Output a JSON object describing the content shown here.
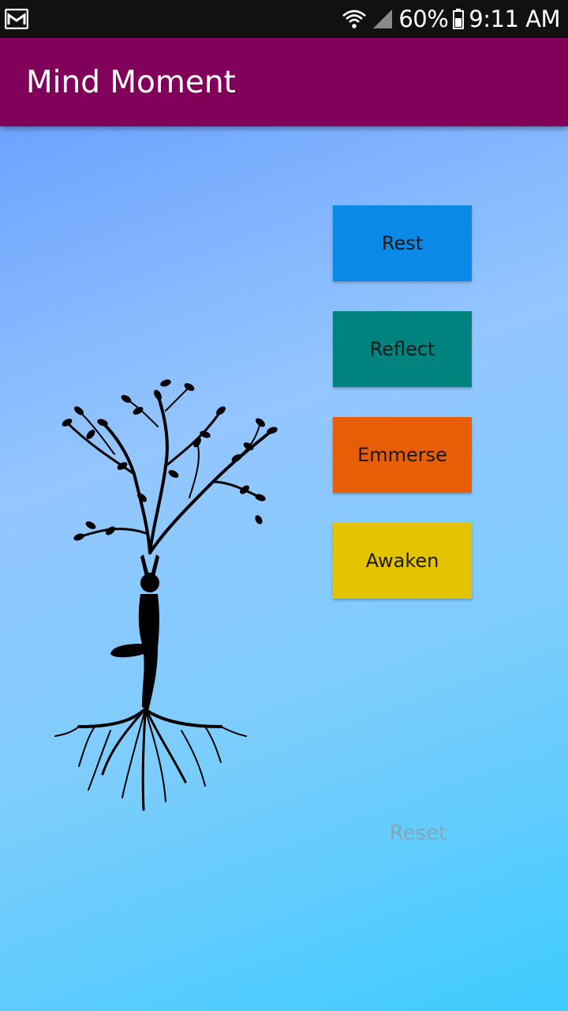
{
  "status_bar": {
    "battery": "60%",
    "time": "9:11 AM",
    "icons": [
      "gmail-icon",
      "wifi-icon",
      "signal-icon",
      "battery-icon"
    ]
  },
  "app_bar": {
    "title": "Mind Moment",
    "color": "#80005a"
  },
  "buttons": [
    {
      "label": "Rest",
      "color": "#0a89e6"
    },
    {
      "label": "Reflect",
      "color": "#00827f"
    },
    {
      "label": "Emmerse",
      "color": "#e85e06"
    },
    {
      "label": "Awaken",
      "color": "#e4c400"
    }
  ],
  "reset_label": "Reset",
  "illustration": "yoga-tree-silhouette"
}
